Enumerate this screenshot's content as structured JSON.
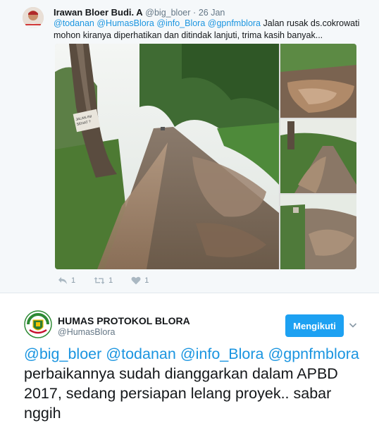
{
  "parent_tweet": {
    "author_name": "Irawan Bloer Budi. A",
    "author_handle": "@big_bloer",
    "separator": "·",
    "date": "26 Jan",
    "mentions": [
      "@todanan",
      "@HumasBlora",
      "@info_Blora",
      "@gpnfmblora"
    ],
    "text": "Jalan rusak ds.cokrowati mohon kiranya diperhatikan dan ditindak lanjuti, trima kasih banyak...",
    "sign_text": "JALAN INI SEHAT? SEGERA DI...",
    "actions": {
      "reply_count": "1",
      "retweet_count": "1",
      "like_count": "1"
    }
  },
  "reply_tweet": {
    "author_name": "HUMAS PROTOKOL BLORA",
    "author_handle": "@HumasBlora",
    "follow_label": "Mengikuti",
    "mentions": [
      "@big_bloer",
      "@todanan",
      "@info_Blora",
      "@gpnfmblora"
    ],
    "text": "perbaikannya sudah dianggarkan dalam APBD 2017, sedang persiapan lelang proyek.. sabar nggih"
  },
  "colors": {
    "link": "#1b95e0",
    "button": "#1da1f2",
    "muted": "#657786",
    "panel_bg": "#f5f8fa"
  },
  "icons": [
    "reply-icon",
    "retweet-icon",
    "heart-icon",
    "chevron-down-icon"
  ]
}
